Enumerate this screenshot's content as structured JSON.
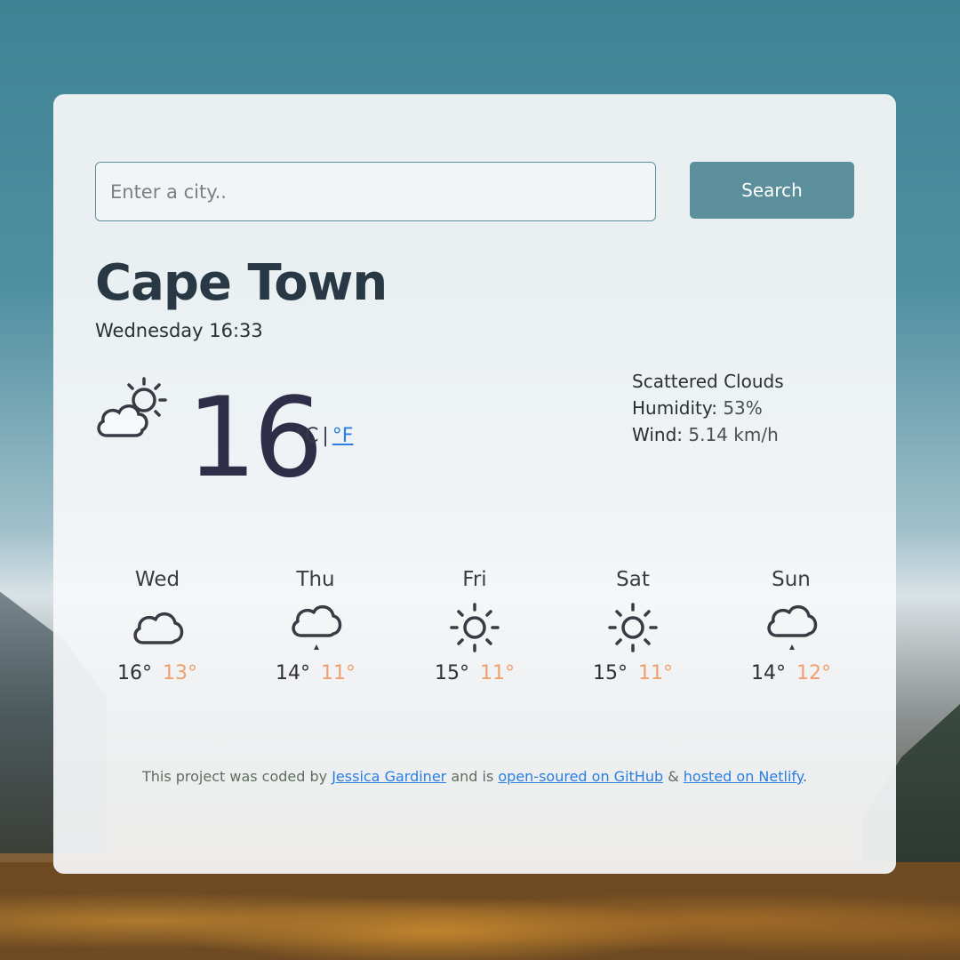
{
  "search": {
    "placeholder": "Enter a city..",
    "button_label": "Search"
  },
  "current": {
    "city": "Cape Town",
    "datetime": "Wednesday 16:33",
    "icon": "partly-cloudy-icon",
    "temperature": "16",
    "unit_celsius": "°C",
    "unit_separator": "|",
    "unit_fahrenheit": "°F",
    "description": "Scattered Clouds",
    "humidity_label": "Humidity:",
    "humidity_value": "53%",
    "wind_label": "Wind:",
    "wind_value": "5.14 km/h"
  },
  "forecast": [
    {
      "day": "Wed",
      "icon": "cloud-icon",
      "max": "16°",
      "min": "13°"
    },
    {
      "day": "Thu",
      "icon": "cloud-rain-icon",
      "max": "14°",
      "min": "11°"
    },
    {
      "day": "Fri",
      "icon": "sun-icon",
      "max": "15°",
      "min": "11°"
    },
    {
      "day": "Sat",
      "icon": "sun-icon",
      "max": "15°",
      "min": "11°"
    },
    {
      "day": "Sun",
      "icon": "cloud-rain-icon",
      "max": "14°",
      "min": "12°"
    }
  ],
  "footer": {
    "text_1": "This project was coded by ",
    "author_link": "Jessica Gardiner",
    "text_2": " and is ",
    "github_link": "open-soured on GitHub",
    "text_3": " & ",
    "netlify_link": "hosted on Netlify",
    "text_4": "."
  },
  "colors": {
    "accent": "#5c8f9c",
    "link": "#2b7ee0",
    "min_temp": "#eea070",
    "title": "#293845"
  }
}
